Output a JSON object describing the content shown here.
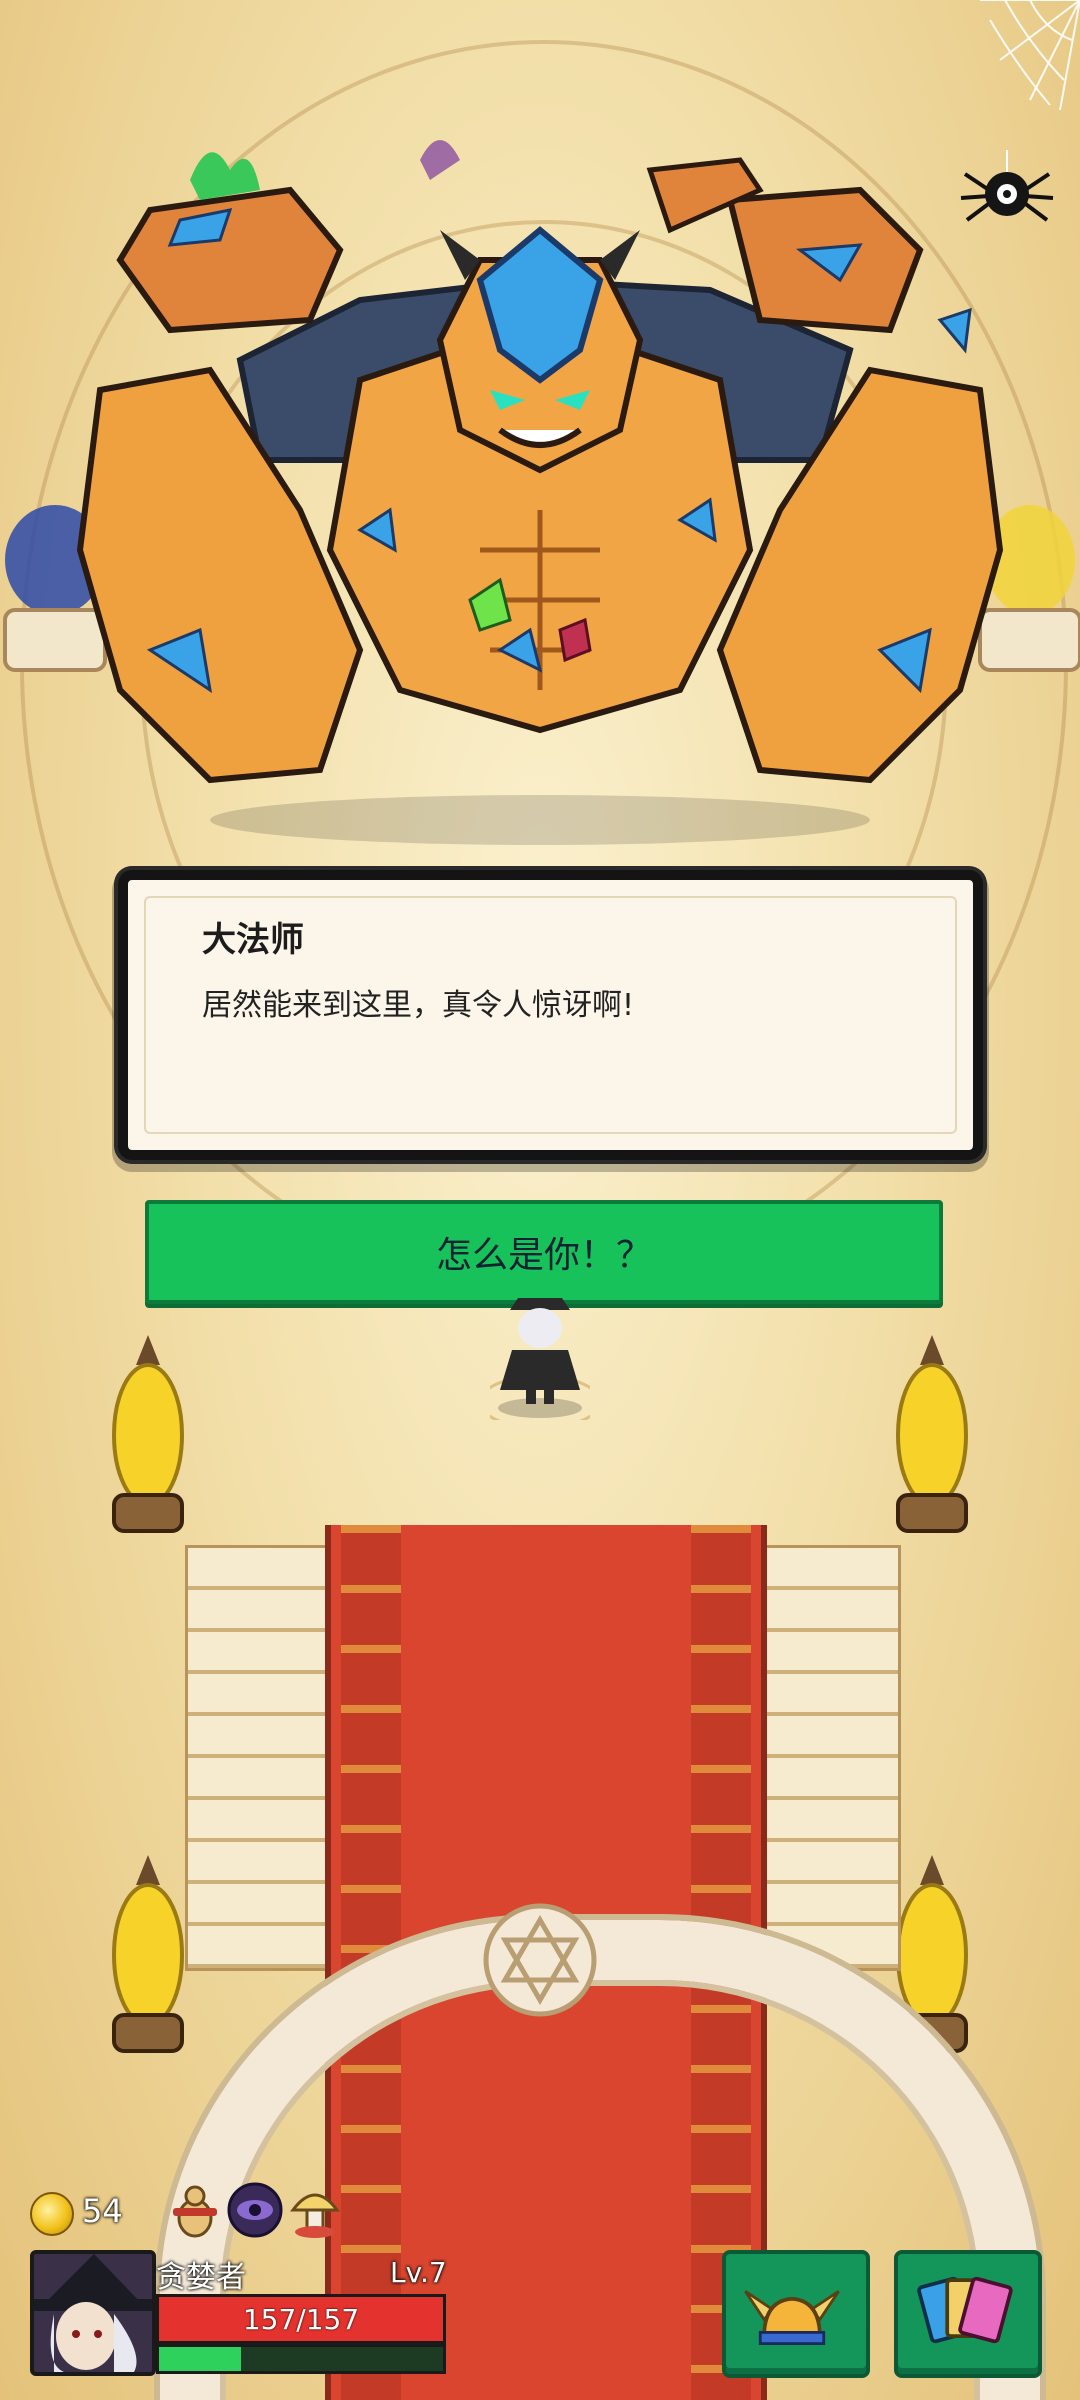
{
  "dialog": {
    "speaker": "大法师",
    "text": "居然能来到这里，真令人惊讶啊!"
  },
  "choices": [
    {
      "label": "怎么是你！？"
    }
  ],
  "hud": {
    "coins": "54",
    "player": {
      "name": "贪婪者",
      "level": "Lv.7",
      "hp_text": "157/157",
      "hp_fraction": 1.0,
      "xp_fraction": 0.29
    },
    "items": [
      "gourd-scroll-icon",
      "eye-rune-icon",
      "mushroom-icon"
    ],
    "buttons": [
      "winged-helmet-icon",
      "card-deck-icon"
    ]
  },
  "colors": {
    "choice": "#17c25b",
    "hp": "#e4332e",
    "xp": "#2fd15d",
    "carpet": "#d9452f",
    "dialog_bg": "#fbf5ea"
  }
}
